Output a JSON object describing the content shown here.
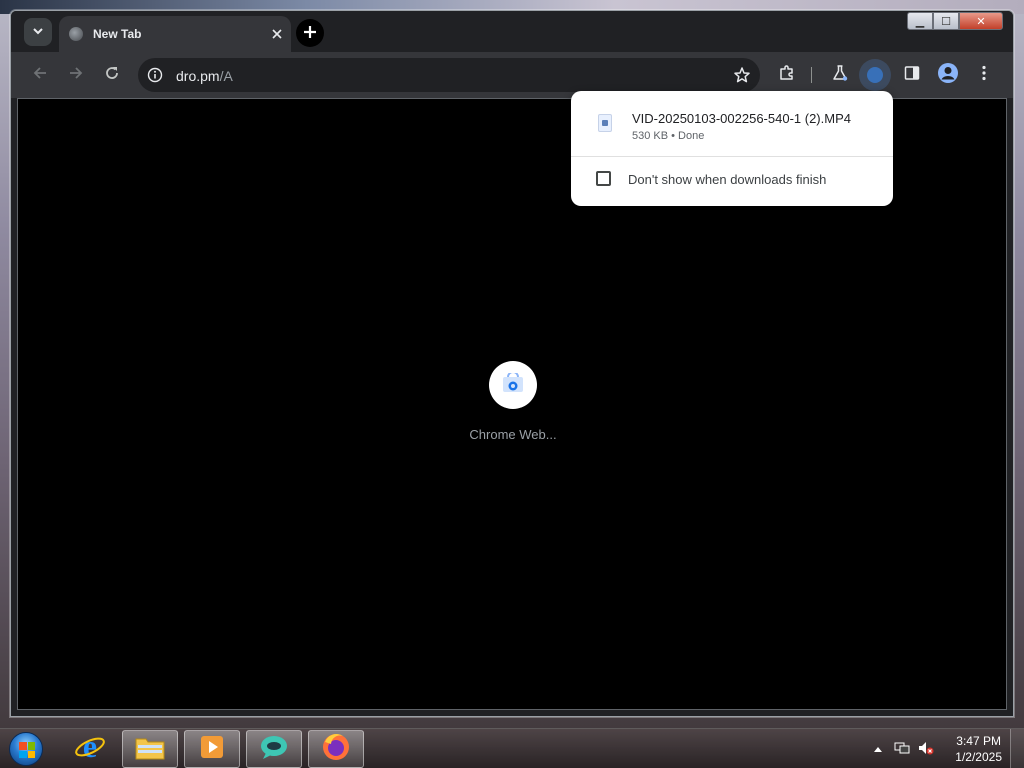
{
  "browser": {
    "tab_title": "New Tab",
    "url_host": "dro.pm",
    "url_path": "/A"
  },
  "window_controls": {
    "minimize": "▁",
    "maximize": "☐",
    "close": "✕"
  },
  "content": {
    "shortcut_label": "Chrome Web..."
  },
  "downloads": {
    "filename": "VID-20250103-002256-540-1 (2).MP4",
    "status": "530 KB • Done",
    "checkbox_label": "Don't show when downloads finish",
    "checkbox_checked": false
  },
  "taskbar": {
    "apps": [
      "start-button",
      "internet-explorer",
      "file-explorer",
      "media-player",
      "chat-app",
      "firefox"
    ],
    "clock_time": "3:47 PM",
    "clock_date": "1/2/2025"
  },
  "colors": {
    "page_background": "#000000",
    "toolbar": "#35363a",
    "tabstrip": "#202124",
    "popup": "#ffffff"
  }
}
